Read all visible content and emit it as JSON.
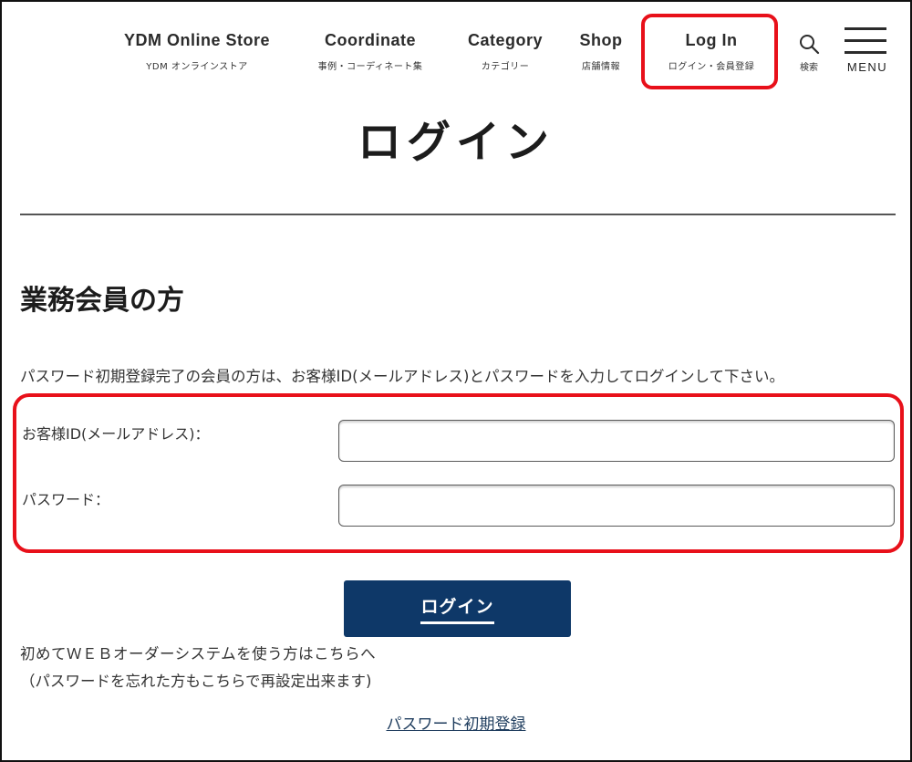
{
  "header": {
    "nav": [
      {
        "en": "YDM Online Store",
        "ja": "YDM オンラインストア"
      },
      {
        "en": "Coordinate",
        "ja": "事例・コーディネート集"
      },
      {
        "en": "Category",
        "ja": "カテゴリー"
      },
      {
        "en": "Shop",
        "ja": "店舗情報"
      },
      {
        "en": "Log In",
        "ja": "ログイン・会員登録"
      }
    ],
    "search_label": "検索",
    "menu_label": "MENU"
  },
  "page": {
    "title": "ログイン",
    "section_title": "業務会員の方",
    "instructions": "パスワード初期登録完了の会員の方は、お客様ID(メールアドレス)とパスワードを入力してログインして下さい。"
  },
  "form": {
    "email_label": "お客様ID(メールアドレス)：",
    "email_value": "",
    "password_label": "パスワード：",
    "password_value": "",
    "submit_label": "ログイン"
  },
  "footer": {
    "info_line1": "初めてＷＥＢオーダーシステムを使う方はこちらへ",
    "info_line2": "（パスワードを忘れた方もこちらで再設定出来ます)",
    "register_link": "パスワード初期登録"
  },
  "colors": {
    "button": "#0e3868",
    "highlight": "#e8101a",
    "link": "#1f3d5e"
  }
}
